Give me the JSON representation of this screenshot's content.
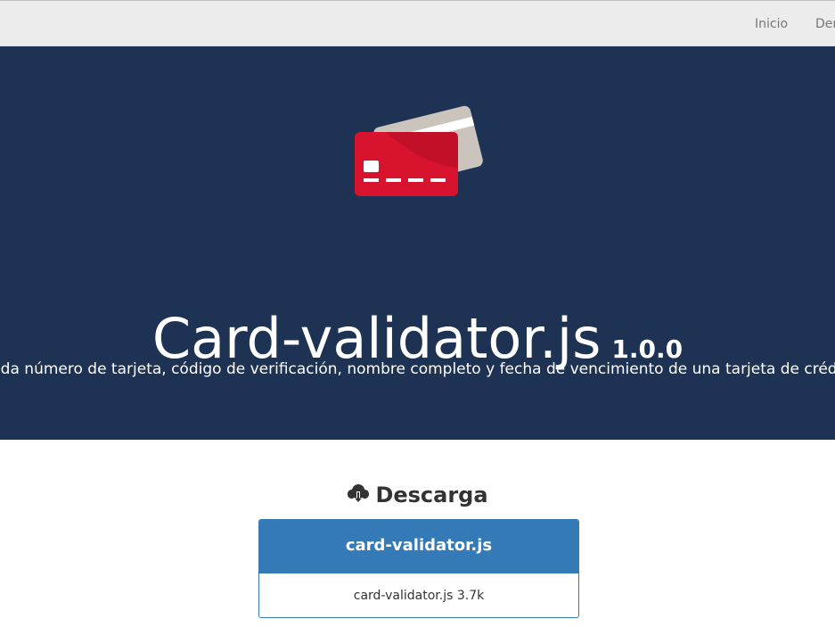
{
  "nav": {
    "items": [
      {
        "label": "Inicio"
      },
      {
        "label": "Demo"
      }
    ]
  },
  "hero": {
    "icon": "credit-card-icon",
    "title": "Card-validator.js",
    "version": "1.0.0",
    "subtitle": "Valida número de tarjeta, código de verificación, nombre completo y fecha de vencimiento de una tarjeta de crédito."
  },
  "download": {
    "icon": "cloud-download-icon",
    "heading": "Descarga",
    "panel_title": "card-validator.js",
    "file_link": "card-validator.js 3.7k"
  },
  "colors": {
    "navbar_bg": "#ececec",
    "hero_bg": "#1e3354",
    "card_front": "#d7132e",
    "card_back": "#cbc4bd",
    "panel_primary": "#337ab7"
  }
}
